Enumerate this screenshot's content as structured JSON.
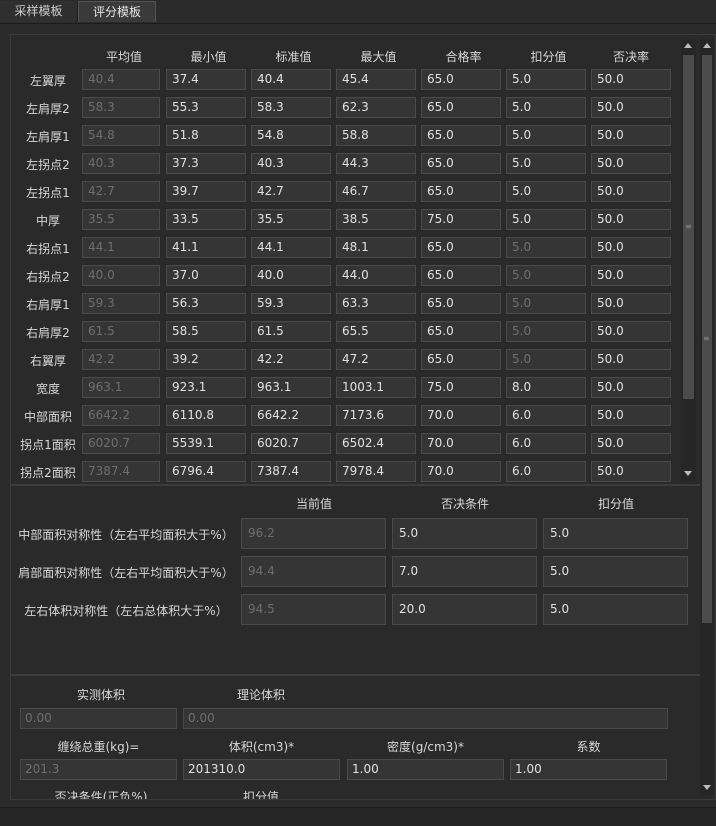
{
  "tabs": [
    "采样模板",
    "评分模板"
  ],
  "grid": {
    "headers": [
      "平均值",
      "最小值",
      "标准值",
      "最大值",
      "合格率",
      "扣分值",
      "否决率"
    ],
    "rows": [
      {
        "label": "左翼厚",
        "values": [
          "40.4",
          "37.4",
          "40.4",
          "45.4",
          "65.0",
          "5.0",
          "50.0"
        ]
      },
      {
        "label": "左肩厚2",
        "values": [
          "58.3",
          "55.3",
          "58.3",
          "62.3",
          "65.0",
          "5.0",
          "50.0"
        ]
      },
      {
        "label": "左肩厚1",
        "values": [
          "54.8",
          "51.8",
          "54.8",
          "58.8",
          "65.0",
          "5.0",
          "50.0"
        ]
      },
      {
        "label": "左拐点2",
        "values": [
          "40.3",
          "37.3",
          "40.3",
          "44.3",
          "65.0",
          "5.0",
          "50.0"
        ]
      },
      {
        "label": "左拐点1",
        "values": [
          "42.7",
          "39.7",
          "42.7",
          "46.7",
          "65.0",
          "5.0",
          "50.0"
        ]
      },
      {
        "label": "中厚",
        "values": [
          "35.5",
          "33.5",
          "35.5",
          "38.5",
          "75.0",
          "5.0",
          "50.0"
        ]
      },
      {
        "label": "右拐点1",
        "values": [
          "44.1",
          "41.1",
          "44.1",
          "48.1",
          "65.0",
          "5.0",
          "50.0"
        ]
      },
      {
        "label": "右拐点2",
        "values": [
          "40.0",
          "37.0",
          "40.0",
          "44.0",
          "65.0",
          "5.0",
          "50.0"
        ]
      },
      {
        "label": "右肩厚1",
        "values": [
          "59.3",
          "56.3",
          "59.3",
          "63.3",
          "65.0",
          "5.0",
          "50.0"
        ]
      },
      {
        "label": "右肩厚2",
        "values": [
          "61.5",
          "58.5",
          "61.5",
          "65.5",
          "65.0",
          "5.0",
          "50.0"
        ]
      },
      {
        "label": "右翼厚",
        "values": [
          "42.2",
          "39.2",
          "42.2",
          "47.2",
          "65.0",
          "5.0",
          "50.0"
        ]
      },
      {
        "label": "宽度",
        "values": [
          "963.1",
          "923.1",
          "963.1",
          "1003.1",
          "75.0",
          "8.0",
          "50.0"
        ]
      },
      {
        "label": "中部面积",
        "values": [
          "6642.2",
          "6110.8",
          "6642.2",
          "7173.6",
          "70.0",
          "6.0",
          "50.0"
        ]
      },
      {
        "label": "拐点1面积",
        "values": [
          "6020.7",
          "5539.1",
          "6020.7",
          "6502.4",
          "70.0",
          "6.0",
          "50.0"
        ]
      },
      {
        "label": "拐点2面积",
        "values": [
          "7387.4",
          "6796.4",
          "7387.4",
          "7978.4",
          "70.0",
          "6.0",
          "50.0"
        ]
      }
    ]
  },
  "symmetry": {
    "headers": [
      "当前值",
      "否决条件",
      "扣分值"
    ],
    "rows": [
      {
        "label": "中部面积对称性（左右平均面积大于%）",
        "values": [
          "96.2",
          "5.0",
          "5.0"
        ]
      },
      {
        "label": "肩部面积对称性（左右平均面积大于%）",
        "values": [
          "94.4",
          "7.0",
          "5.0"
        ]
      },
      {
        "label": "左右体积对称性（左右总体积大于%）",
        "values": [
          "94.5",
          "20.0",
          "5.0"
        ]
      }
    ]
  },
  "volume": {
    "measured_label": "实测体积",
    "theory_label": "理论体积",
    "measured_value": "0.00",
    "theory_value": "0.00",
    "weight_label": "缠绕总重(kg)=",
    "vol_label": "体积(cm3)*",
    "density_label": "密度(g/cm3)*",
    "coef_label": "系数",
    "weight_value": "201.3",
    "vol_value": "201310.0",
    "density_value": "1.00",
    "coef_value": "1.00",
    "veto_label": "否决条件(正负%)",
    "deduct_label": "扣分值"
  }
}
